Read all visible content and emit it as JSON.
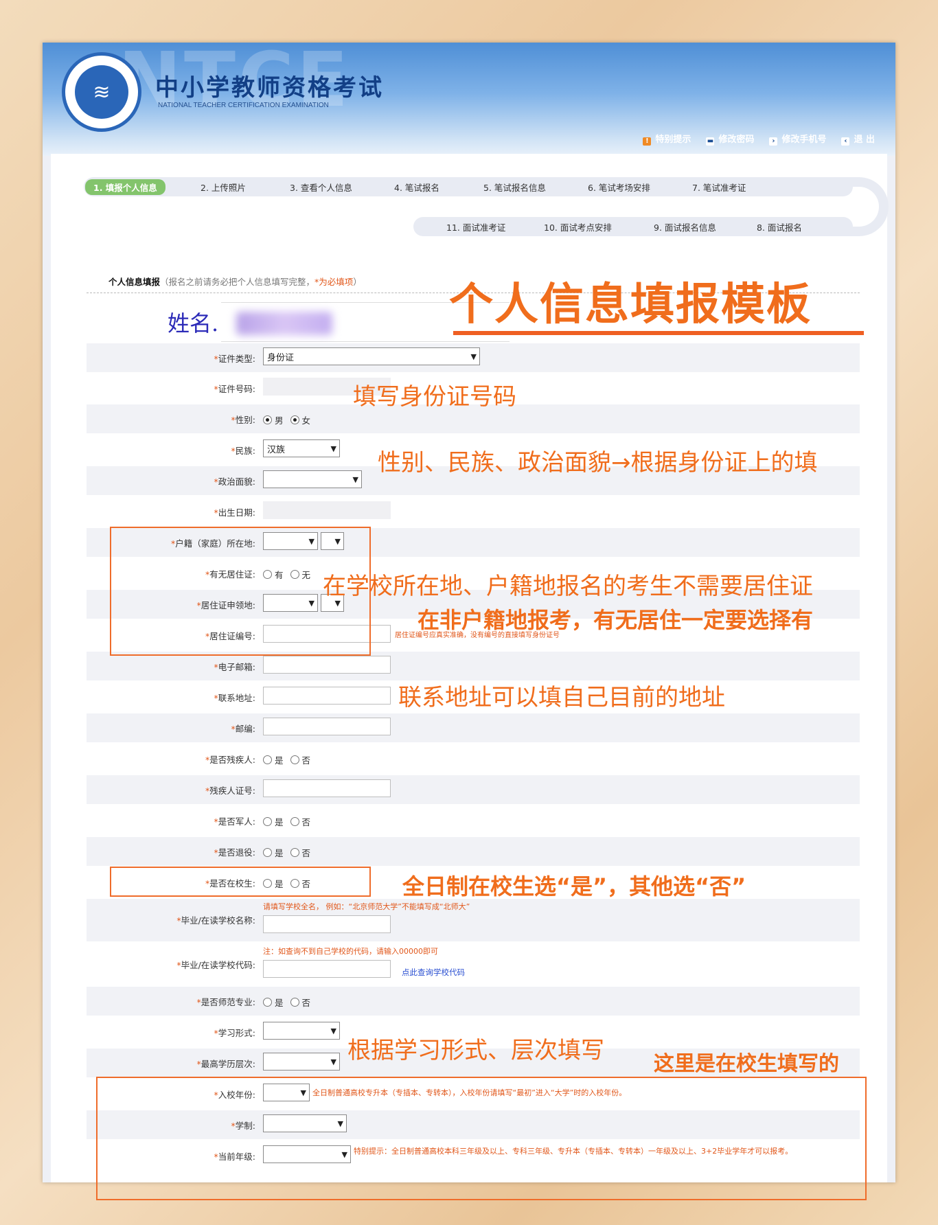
{
  "header": {
    "watermark": "NTCE",
    "title": "中小学教师资格考试",
    "subtitle": "NATIONAL TEACHER CERTIFICATION EXAMINATION",
    "nav": [
      {
        "label": "特别提示",
        "icon": "info-icon"
      },
      {
        "label": "修改密码",
        "icon": "key-icon"
      },
      {
        "label": "修改手机号",
        "icon": "phone-icon"
      },
      {
        "label": "退 出",
        "icon": "logout-icon"
      }
    ]
  },
  "steps": [
    {
      "label": "1. 填报个人信息",
      "active": true
    },
    {
      "label": "2. 上传照片"
    },
    {
      "label": "3. 查看个人信息"
    },
    {
      "label": "4. 笔试报名"
    },
    {
      "label": "5. 笔试报名信息"
    },
    {
      "label": "6. 笔试考场安排"
    },
    {
      "label": "7. 笔试准考证"
    },
    {
      "label": "11. 面试准考证"
    },
    {
      "label": "10. 面试考点安排"
    },
    {
      "label": "9. 面试报名信息"
    },
    {
      "label": "8. 面试报名"
    }
  ],
  "section": {
    "title": "个人信息填报",
    "note": "（报名之前请务必把个人信息填写完整，",
    "req_note": "*为必填项",
    "close": "）"
  },
  "name_label": "姓名.",
  "form": {
    "id_type": {
      "label": "证件类型:",
      "value": "身份证"
    },
    "id_number": {
      "label": "证件号码:"
    },
    "gender": {
      "label": "性别:",
      "options": [
        "男",
        "女"
      ]
    },
    "ethnicity": {
      "label": "民族:",
      "value": "汉族"
    },
    "political": {
      "label": "政治面貌:"
    },
    "birthdate": {
      "label": "出生日期:"
    },
    "hukou": {
      "label": "户籍（家庭）所在地:"
    },
    "has_residence": {
      "label": "有无居住证:",
      "options": [
        "有",
        "无"
      ]
    },
    "residence_place": {
      "label": "居住证申领地:"
    },
    "residence_no": {
      "label": "居住证编号:",
      "hint": "居住证编号应真实准确，没有编号的直接填写身份证号"
    },
    "email": {
      "label": "电子邮箱:"
    },
    "address": {
      "label": "联系地址:"
    },
    "zip": {
      "label": "邮编:"
    },
    "disabled": {
      "label": "是否残疾人:",
      "options": [
        "是",
        "否"
      ]
    },
    "disabled_no": {
      "label": "残疾人证号:"
    },
    "military": {
      "label": "是否军人:",
      "options": [
        "是",
        "否"
      ]
    },
    "retired": {
      "label": "是否退役:",
      "options": [
        "是",
        "否"
      ]
    },
    "student": {
      "label": "是否在校生:",
      "options": [
        "是",
        "否"
      ]
    },
    "school_name": {
      "label": "毕业/在读学校名称:",
      "hint": "请填写学校全名，  例如：“北京师范大学”不能填写成“北师大”"
    },
    "school_code": {
      "label": "毕业/在读学校代码:",
      "hint": "注：如查询不到自己学校的代码，请输入00000即可",
      "link": "点此查询学校代码"
    },
    "normal_major": {
      "label": "是否师范专业:",
      "options": [
        "是",
        "否"
      ]
    },
    "study_form": {
      "label": "学习形式:"
    },
    "edu_level": {
      "label": "最高学历层次:"
    },
    "entry_year": {
      "label": "入校年份:",
      "hint": "全日制普通高校专升本（专插本、专转本），入校年份请填写“最初”进入“大学”时的入校年份。"
    },
    "schooling": {
      "label": "学制:"
    },
    "grade": {
      "label": "当前年级:",
      "hint": "特别提示：全日制普通高校本科三年级及以上、专科三年级、专升本（专插本、专转本）一年级及以上、3+2毕业学年才可以报考。"
    }
  },
  "annotations": {
    "title": "个人信息填报模板",
    "id_number": "填写身份证号码",
    "gender": "性别、民族、政治面貌→根据身份证上的填",
    "residence1": "在学校所在地、户籍地报名的考生不需要居住证",
    "residence2": "在非户籍地报考，有无居住一定要选择有",
    "address": "联系地址可以填自己目前的地址",
    "student": "全日制在校生选“是”，其他选“否”",
    "study": "根据学习形式、层次填写",
    "current_student": "这里是在校生填写的"
  },
  "colors": {
    "accent": "#f06d1c",
    "active_step": "#83c46c",
    "header": "#4f8fd6"
  }
}
